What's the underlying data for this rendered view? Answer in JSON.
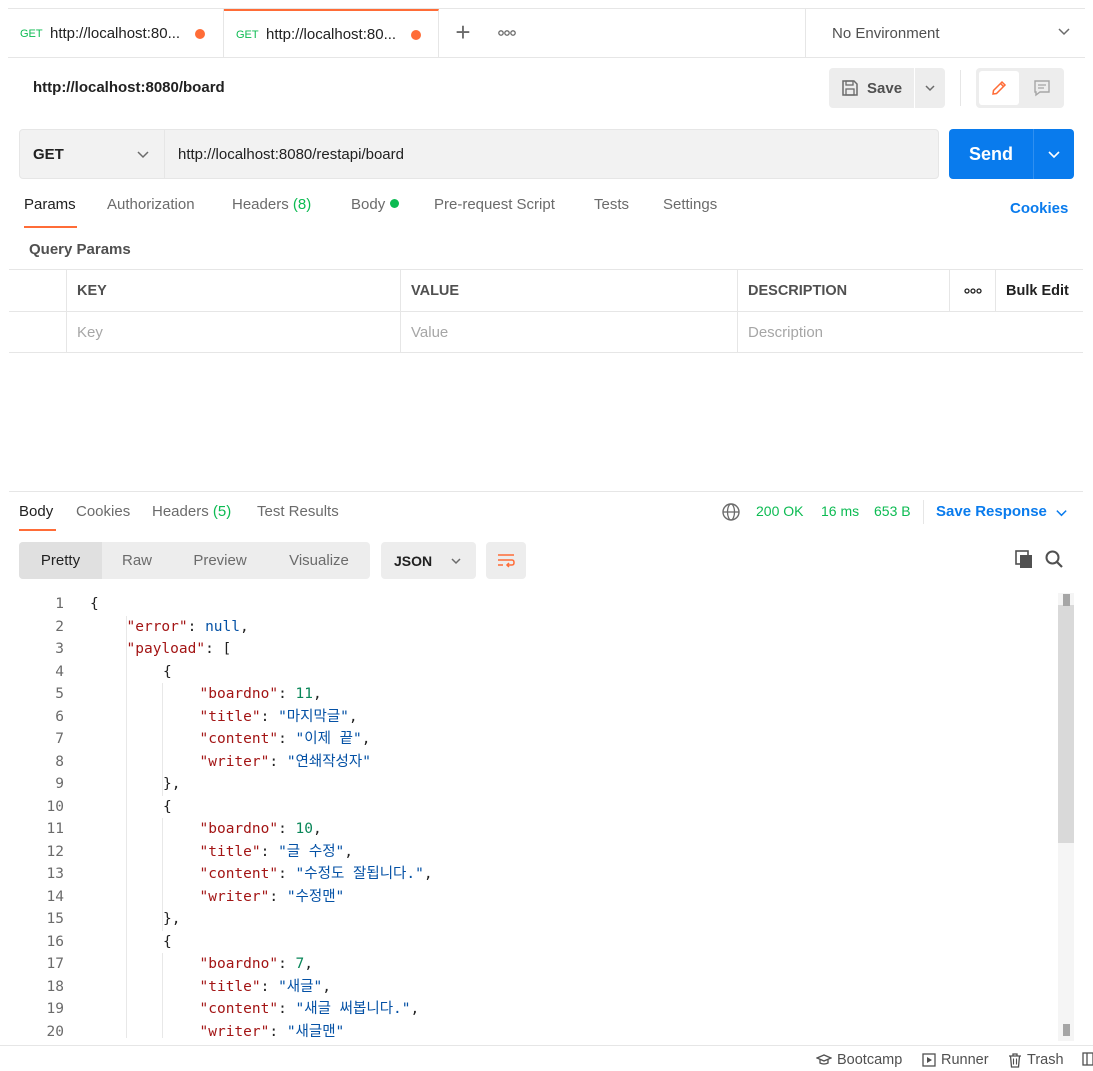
{
  "tabs": [
    {
      "method": "GET",
      "url": "http://localhost:80...",
      "unsaved": true
    },
    {
      "method": "GET",
      "url": "http://localhost:80...",
      "unsaved": true,
      "active": true
    }
  ],
  "environment": {
    "selected": "No Environment"
  },
  "request": {
    "title": "http://localhost:8080/board",
    "save_label": "Save",
    "method": "GET",
    "url": "http://localhost:8080/restapi/board",
    "send_label": "Send"
  },
  "request_tabs": {
    "params": "Params",
    "authorization": "Authorization",
    "headers": "Headers",
    "headers_count": "(8)",
    "body": "Body",
    "prerequest": "Pre-request Script",
    "tests": "Tests",
    "settings": "Settings",
    "cookies": "Cookies"
  },
  "query_params": {
    "title": "Query Params",
    "columns": {
      "key": "KEY",
      "value": "VALUE",
      "description": "DESCRIPTION",
      "bulk_edit": "Bulk Edit"
    },
    "placeholders": {
      "key": "Key",
      "value": "Value",
      "description": "Description"
    }
  },
  "response": {
    "tabs": {
      "body": "Body",
      "cookies": "Cookies",
      "headers": "Headers",
      "headers_count": "(5)",
      "test_results": "Test Results"
    },
    "status": "200 OK",
    "time": "16 ms",
    "size": "653 B",
    "save_response": "Save Response",
    "views": {
      "pretty": "Pretty",
      "raw": "Raw",
      "preview": "Preview",
      "visualize": "Visualize"
    },
    "format": "JSON"
  },
  "code_lines": [
    {
      "n": "1",
      "indent": 0,
      "parts": [
        [
          "p",
          "{"
        ]
      ]
    },
    {
      "n": "2",
      "indent": 1,
      "parts": [
        [
          "k",
          "\"error\""
        ],
        [
          "p",
          ": "
        ],
        [
          "nl",
          "null"
        ],
        [
          "p",
          ","
        ]
      ]
    },
    {
      "n": "3",
      "indent": 1,
      "parts": [
        [
          "k",
          "\"payload\""
        ],
        [
          "p",
          ": ["
        ]
      ]
    },
    {
      "n": "4",
      "indent": 2,
      "parts": [
        [
          "p",
          "{"
        ]
      ]
    },
    {
      "n": "5",
      "indent": 3,
      "parts": [
        [
          "k",
          "\"boardno\""
        ],
        [
          "p",
          ": "
        ],
        [
          "n",
          "11"
        ],
        [
          "p",
          ","
        ]
      ]
    },
    {
      "n": "6",
      "indent": 3,
      "parts": [
        [
          "k",
          "\"title\""
        ],
        [
          "p",
          ": "
        ],
        [
          "s",
          "\"마지막글\""
        ],
        [
          "p",
          ","
        ]
      ]
    },
    {
      "n": "7",
      "indent": 3,
      "parts": [
        [
          "k",
          "\"content\""
        ],
        [
          "p",
          ": "
        ],
        [
          "s",
          "\"이제 끝\""
        ],
        [
          "p",
          ","
        ]
      ]
    },
    {
      "n": "8",
      "indent": 3,
      "parts": [
        [
          "k",
          "\"writer\""
        ],
        [
          "p",
          ": "
        ],
        [
          "s",
          "\"연쇄작성자\""
        ]
      ]
    },
    {
      "n": "9",
      "indent": 2,
      "parts": [
        [
          "p",
          "},"
        ]
      ]
    },
    {
      "n": "10",
      "indent": 2,
      "parts": [
        [
          "p",
          "{"
        ]
      ]
    },
    {
      "n": "11",
      "indent": 3,
      "parts": [
        [
          "k",
          "\"boardno\""
        ],
        [
          "p",
          ": "
        ],
        [
          "n",
          "10"
        ],
        [
          "p",
          ","
        ]
      ]
    },
    {
      "n": "12",
      "indent": 3,
      "parts": [
        [
          "k",
          "\"title\""
        ],
        [
          "p",
          ": "
        ],
        [
          "s",
          "\"글 수정\""
        ],
        [
          "p",
          ","
        ]
      ]
    },
    {
      "n": "13",
      "indent": 3,
      "parts": [
        [
          "k",
          "\"content\""
        ],
        [
          "p",
          ": "
        ],
        [
          "s",
          "\"수정도 잘됩니다.\""
        ],
        [
          "p",
          ","
        ]
      ]
    },
    {
      "n": "14",
      "indent": 3,
      "parts": [
        [
          "k",
          "\"writer\""
        ],
        [
          "p",
          ": "
        ],
        [
          "s",
          "\"수정맨\""
        ]
      ]
    },
    {
      "n": "15",
      "indent": 2,
      "parts": [
        [
          "p",
          "},"
        ]
      ]
    },
    {
      "n": "16",
      "indent": 2,
      "parts": [
        [
          "p",
          "{"
        ]
      ]
    },
    {
      "n": "17",
      "indent": 3,
      "parts": [
        [
          "k",
          "\"boardno\""
        ],
        [
          "p",
          ": "
        ],
        [
          "n",
          "7"
        ],
        [
          "p",
          ","
        ]
      ]
    },
    {
      "n": "18",
      "indent": 3,
      "parts": [
        [
          "k",
          "\"title\""
        ],
        [
          "p",
          ": "
        ],
        [
          "s",
          "\"새글\""
        ],
        [
          "p",
          ","
        ]
      ]
    },
    {
      "n": "19",
      "indent": 3,
      "parts": [
        [
          "k",
          "\"content\""
        ],
        [
          "p",
          ": "
        ],
        [
          "s",
          "\"새글 써봅니다.\""
        ],
        [
          "p",
          ","
        ]
      ]
    },
    {
      "n": "20",
      "indent": 3,
      "parts": [
        [
          "k",
          "\"writer\""
        ],
        [
          "p",
          ": "
        ],
        [
          "s",
          "\"새글맨\""
        ]
      ]
    }
  ],
  "footer": {
    "bootcamp": "Bootcamp",
    "runner": "Runner",
    "trash": "Trash"
  },
  "colors": {
    "accent": "#ff6c37",
    "primary": "#097bed",
    "success": "#0cbb52"
  }
}
